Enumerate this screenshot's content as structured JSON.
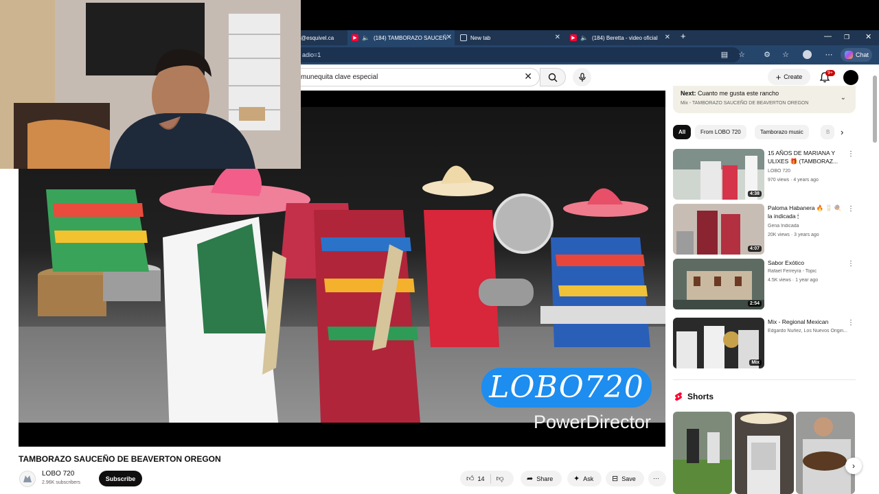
{
  "browser": {
    "tabs": [
      {
        "label": "@esquivel.ca"
      },
      {
        "label": "(184) TAMBORAZO SAUCEÑ"
      },
      {
        "label": "New tab"
      },
      {
        "label": "(184) Beretta - video oficial"
      }
    ],
    "address": "adio=1",
    "chat_label": "Chat"
  },
  "youtube": {
    "search_value": "munequita clave especial",
    "create_label": "Create",
    "notification_badge": "9+"
  },
  "video": {
    "watermark": "LOBO720",
    "editor_watermark": "PowerDirector",
    "title": "TAMBORAZO SAUCEÑO DE BEAVERTON OREGON",
    "channel": "LOBO 720",
    "subscribers": "2.96K subscribers",
    "subscribe_label": "Subscribe",
    "likes": "14",
    "share_label": "Share",
    "ask_label": "Ask",
    "save_label": "Save"
  },
  "sidebar": {
    "next_prefix": "Next:",
    "next_title": "Cuanto me gusta este rancho",
    "next_sub": "Mix - TAMBORAZO SAUCEÑO DE BEAVERTON OREGON",
    "chips": [
      "All",
      "From LOBO 720",
      "Tamborazo music",
      "B"
    ],
    "recommendations": [
      {
        "title": "15 AÑOS DE MARIANA Y ULIXES 🎁 (TAMBORAZ...",
        "channel": "LOBO 720",
        "meta": "970 views · 4 years ago",
        "duration": "4:38"
      },
      {
        "title": "Paloma Habanera 🔥 🥛 🍭 la indicada 🕯",
        "channel": "Gena Indicada",
        "meta": "20K views · 3 years ago",
        "duration": "4:07"
      },
      {
        "title": "Sabor Exótico",
        "channel": "Rafael Ferreyra - Topic",
        "meta": "4.5K views · 1 year ago",
        "duration": "2:54"
      },
      {
        "title": "Mix - Regional Mexican",
        "channel": "Edgardo Nuñez, Los Nuevos Origin...",
        "meta": "",
        "duration": "Mix"
      }
    ],
    "shorts_label": "Shorts"
  },
  "colors": {
    "accent_red": "#ff0033",
    "browser_dark": "#1f3552",
    "watermark_blue": "#1d8df0"
  }
}
